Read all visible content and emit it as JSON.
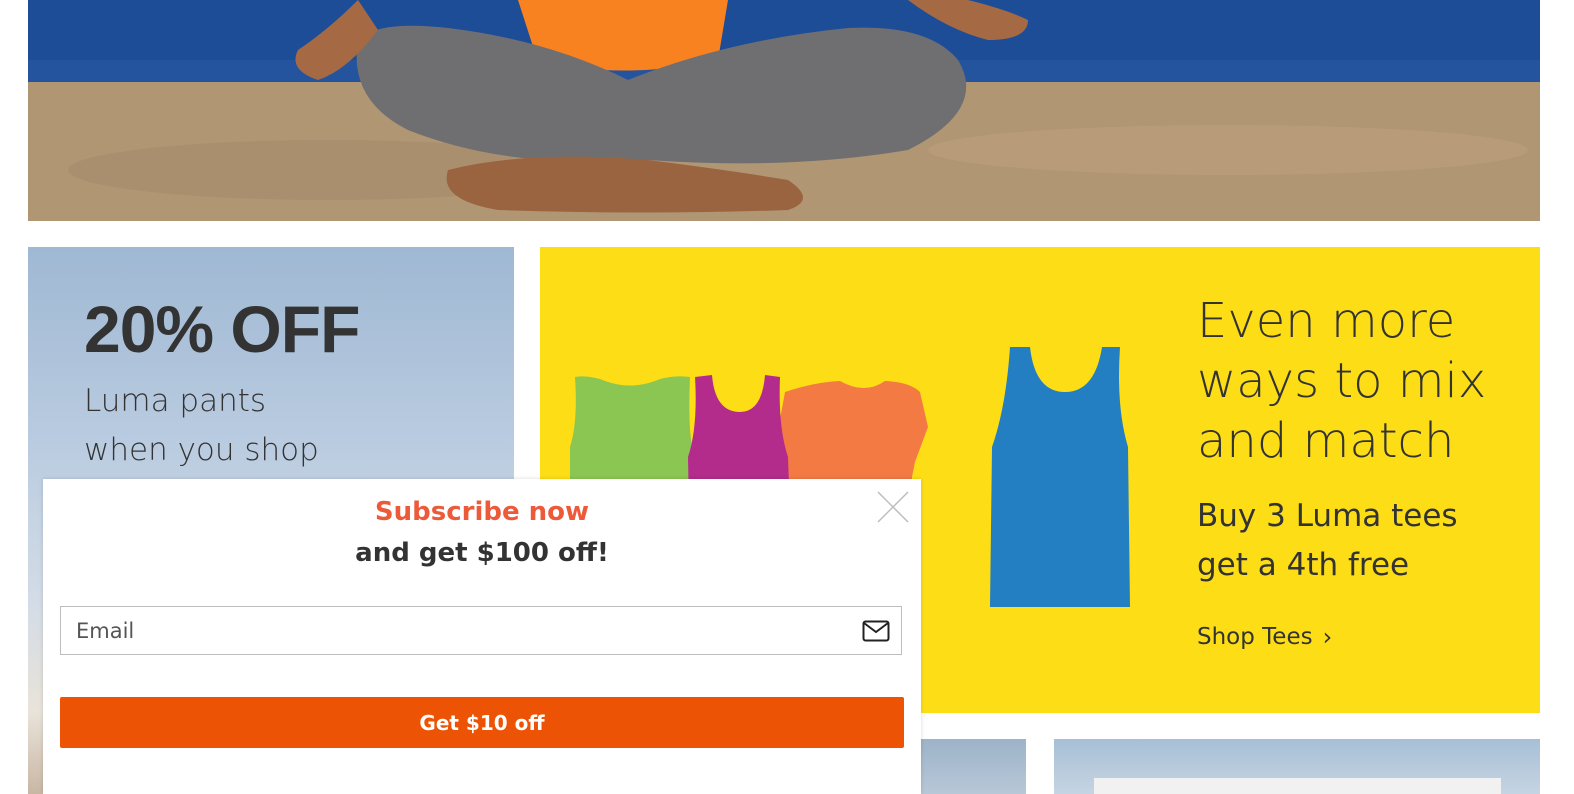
{
  "pants_promo": {
    "headline": "20% OFF",
    "line1": "Luma pants",
    "line2": "when you shop"
  },
  "tees_promo": {
    "title_line1": "Even more",
    "title_line2": "ways to mix",
    "title_line3": "and match",
    "info_line1": "Buy 3 Luma tees",
    "info_line2": "get a 4th free",
    "shop_link": "Shop Tees",
    "colors": {
      "background": "#fdde16",
      "tee_green": "#8cc652",
      "tee_magenta": "#b42c8b",
      "tee_orange": "#f47a43",
      "tee_blue": "#237fc1"
    }
  },
  "subscribe_modal": {
    "title": "Subscribe now",
    "subtitle": "and get $100 off!",
    "email_placeholder": "Email",
    "email_icon": "envelope-icon",
    "close_icon": "close-icon",
    "button_label": "Get $10 off",
    "colors": {
      "title": "#ec5a3a",
      "button": "#ec5304"
    }
  }
}
